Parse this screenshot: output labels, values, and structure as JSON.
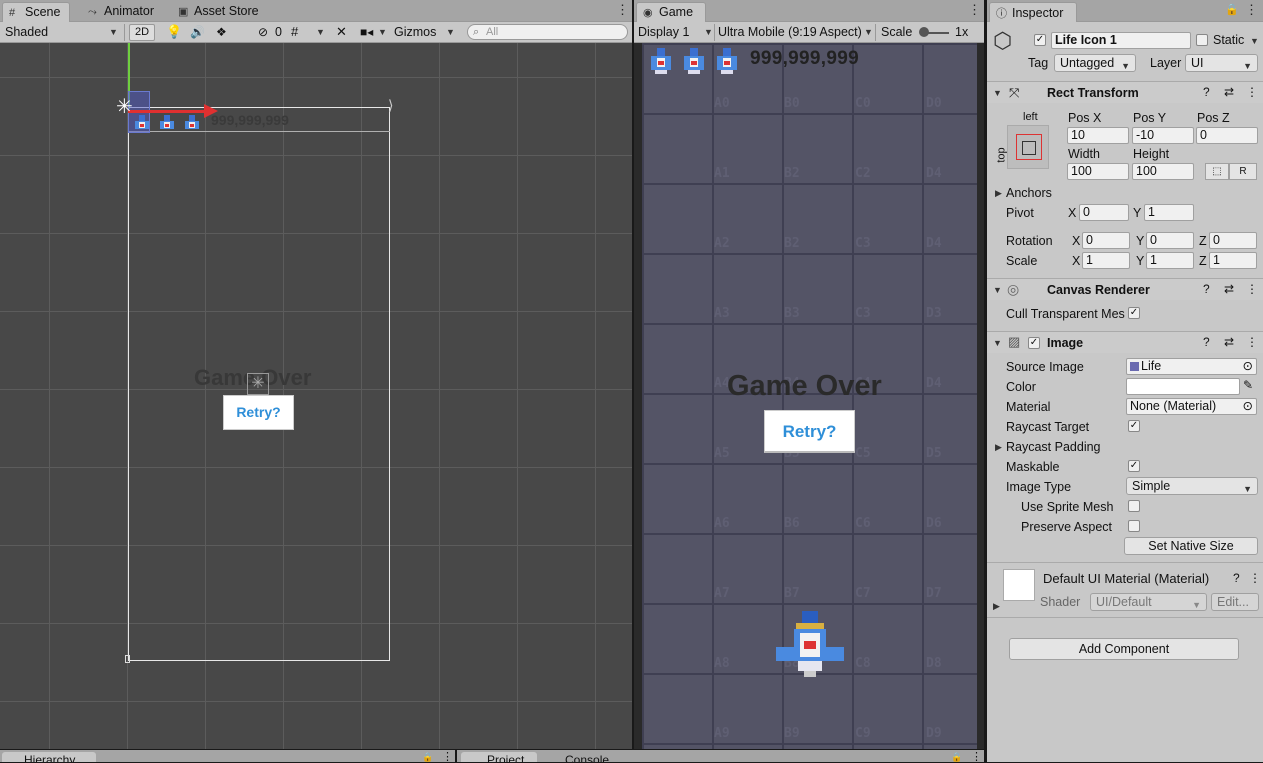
{
  "scene_panel": {
    "tabs": [
      {
        "label": "Scene",
        "icon": "hash-icon"
      },
      {
        "label": "Animator",
        "icon": "animator-icon"
      },
      {
        "label": "Asset Store",
        "icon": "store-icon"
      }
    ],
    "toolbar": {
      "shading_mode": "Shaded",
      "mode_2d": "2D",
      "hidden_count": "0",
      "gizmos_label": "Gizmos",
      "search_placeholder": "All"
    },
    "canvas_preview": {
      "score": "999,999,999",
      "game_over": "Game Over",
      "retry": "Retry?"
    }
  },
  "game_panel": {
    "tab_label": "Game",
    "display": "Display 1",
    "aspect": "Ultra Mobile (9:19 Aspect)",
    "scale_label": "Scale",
    "scale_value": "1x",
    "score": "999,999,999",
    "game_over": "Game Over",
    "retry": "Retry?",
    "cell_labels": [
      [
        "A0",
        "B0",
        "C0",
        "D0"
      ],
      [
        "A1",
        "B2",
        "C2",
        "D4"
      ],
      [
        "A2",
        "B2",
        "C3",
        "D4"
      ],
      [
        "A3",
        "B3",
        "C3",
        "D3"
      ],
      [
        "A4",
        "B4",
        "C4",
        "D4"
      ],
      [
        "A5",
        "B5",
        "C5",
        "D5"
      ],
      [
        "A6",
        "B6",
        "C6",
        "D6"
      ],
      [
        "A7",
        "B7",
        "C7",
        "D7"
      ],
      [
        "A8",
        "B8",
        "C8",
        "D8"
      ],
      [
        "A9",
        "B9",
        "C9",
        "D9"
      ]
    ]
  },
  "inspector": {
    "tab_label": "Inspector",
    "object_name": "Life Icon 1",
    "static_label": "Static",
    "tag_label": "Tag",
    "tag_value": "Untagged",
    "layer_label": "Layer",
    "layer_value": "UI",
    "rect_transform": {
      "title": "Rect Transform",
      "anchor_h": "left",
      "anchor_v": "top",
      "pos_x_label": "Pos X",
      "pos_x": "10",
      "pos_y_label": "Pos Y",
      "pos_y": "-10",
      "pos_z_label": "Pos Z",
      "pos_z": "0",
      "width_label": "Width",
      "width": "100",
      "height_label": "Height",
      "height": "100",
      "raw_btn": "R",
      "anchors_label": "Anchors",
      "pivot_label": "Pivot",
      "pivot_x": "0",
      "pivot_y": "1",
      "rotation_label": "Rotation",
      "rot_x": "0",
      "rot_y": "0",
      "rot_z": "0",
      "scale_label": "Scale",
      "scale_x": "1",
      "scale_y": "1",
      "scale_z": "1",
      "x": "X",
      "y": "Y",
      "z": "Z"
    },
    "canvas_renderer": {
      "title": "Canvas Renderer",
      "cull_label": "Cull Transparent Mes"
    },
    "image": {
      "title": "Image",
      "source_label": "Source Image",
      "source_value": "Life",
      "color_label": "Color",
      "material_label": "Material",
      "material_value": "None (Material)",
      "raycast_label": "Raycast Target",
      "raycast_padding_label": "Raycast Padding",
      "maskable_label": "Maskable",
      "image_type_label": "Image Type",
      "image_type_value": "Simple",
      "sprite_mesh_label": "Use Sprite Mesh",
      "preserve_label": "Preserve Aspect",
      "native_size_btn": "Set Native Size"
    },
    "material": {
      "title": "Default UI Material (Material)",
      "shader_label": "Shader",
      "shader_value": "UI/Default",
      "edit_btn": "Edit..."
    },
    "add_component": "Add Component"
  },
  "bottom_tabs": {
    "hierarchy": "Hierarchy",
    "project": "Project",
    "console": "Console"
  },
  "colors": {
    "accent_retry": "#2f8fd8",
    "game_bg": "#545466",
    "scene_bg": "#484848"
  }
}
